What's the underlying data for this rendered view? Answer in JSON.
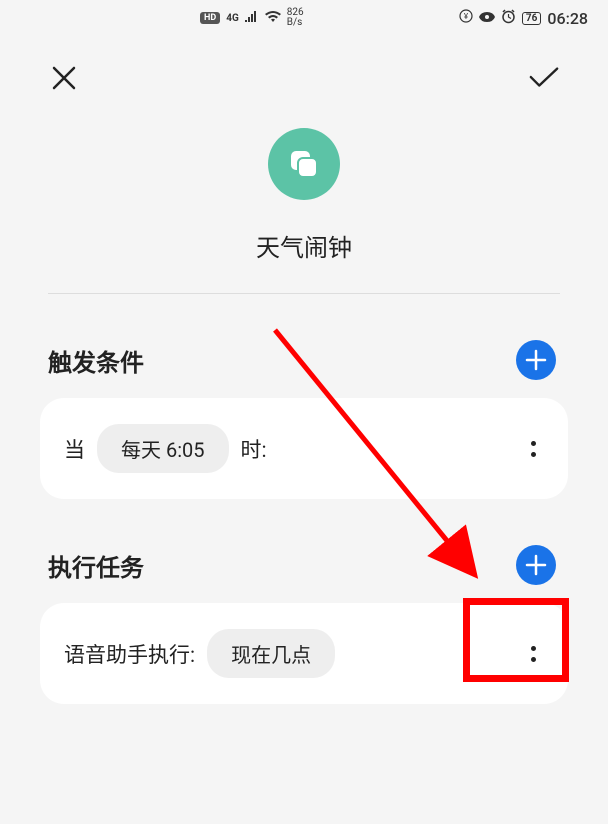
{
  "status_bar": {
    "hd": "HD",
    "network": "4G",
    "speed_top": "826",
    "speed_bottom": "B/s",
    "battery": "76",
    "time": "06:28"
  },
  "app": {
    "title": "天气闹钟"
  },
  "trigger": {
    "section_title": "触发条件",
    "prefix": "当",
    "value": "每天 6:05",
    "suffix": "时:"
  },
  "task": {
    "section_title": "执行任务",
    "prefix": "语音助手执行:",
    "value": "现在几点"
  }
}
